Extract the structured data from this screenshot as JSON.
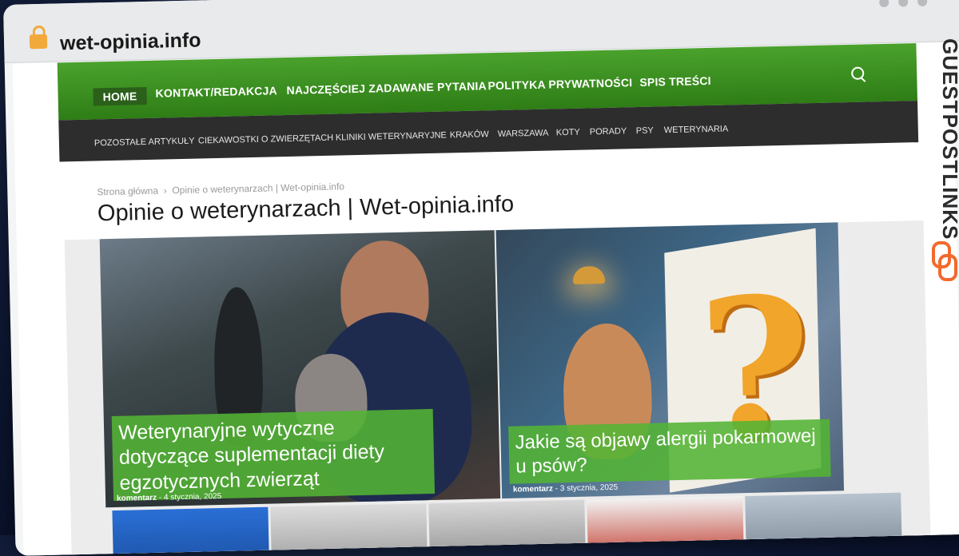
{
  "browser": {
    "url": "wet-opinia.info"
  },
  "side_brand": "GUESTPOSTLINKS",
  "nav": {
    "home": "HOME",
    "items": [
      "KONTAKT/REDAKCJA",
      "NAJCZĘŚCIEJ ZADAWANE PYTANIA",
      "POLITYKA PRYWATNOŚCI",
      "SPIS TREŚCI"
    ]
  },
  "subnav": {
    "items": [
      "POZOSTAŁE ARTYKUŁY",
      "CIEKAWOSTKI O ZWIERZĘTACH",
      "KLINIKI WETERYNARYJNE",
      "KRAKÓW",
      "WARSZAWA",
      "KOTY",
      "PORADY",
      "PSY",
      "WETERYNARIA"
    ]
  },
  "breadcrumb": {
    "home": "Strona główna",
    "sep": "›",
    "current": "Opinie o weterynarzach | Wet-opinia.info"
  },
  "page_title": "Opinie o weterynarzach | Wet-opinia.info",
  "featured": [
    {
      "title": "Weterynaryjne wytyczne dotyczące suplementacji diety egzotycznych zwierząt",
      "author": "komentarz",
      "sep": "-",
      "date": "4 stycznia, 2025"
    },
    {
      "title": "Jakie są objawy alergii pokarmowej u psów?",
      "author": "komentarz",
      "sep": "-",
      "date": "3 stycznia, 2025"
    }
  ],
  "colors": {
    "nav_green": "#3f9424",
    "subnav_dark": "#2d2d2d",
    "caption_green": "#53b434",
    "brand_orange": "#f26a2e"
  }
}
